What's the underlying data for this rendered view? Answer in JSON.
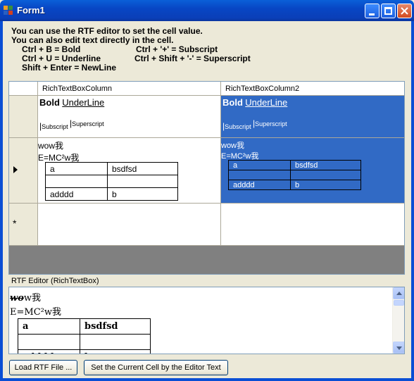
{
  "window": {
    "title": "Form1"
  },
  "help": [
    "You can use the RTF editor to set the cell value.",
    "You can also edit text directly in the cell.",
    "Ctrl + B = Bold",
    "Ctrl + '+' = Subscript",
    "Ctrl + U = Underline",
    "Ctrl + Shift + '-' = Superscript",
    "Shift + Enter = NewLine"
  ],
  "grid": {
    "columns": [
      "RichTextBoxColumn",
      "RichTextBoxColumn2"
    ],
    "new_row_marker": "*",
    "row1": {
      "bold": "Bold",
      "underline": "UnderLine",
      "subscript": "Subscript",
      "superscript": "Superscript"
    },
    "row2": {
      "line1": "wow我",
      "line2": "E=MC²w我",
      "table": [
        [
          "a",
          "bsdfsd"
        ],
        [
          "",
          ""
        ],
        [
          "adddd",
          "b"
        ]
      ]
    }
  },
  "editor": {
    "label": "RTF Editor (RichTextBox)",
    "line1_strike": "wo",
    "line1_rest": "w我",
    "line2": "E=MC²w我",
    "table": [
      [
        "a",
        "bsdfsd"
      ],
      [
        "",
        ""
      ],
      [
        "adddd",
        "b"
      ]
    ]
  },
  "buttons": {
    "load": "Load RTF File ...",
    "set": "Set  the Current Cell by the Editor Text"
  }
}
